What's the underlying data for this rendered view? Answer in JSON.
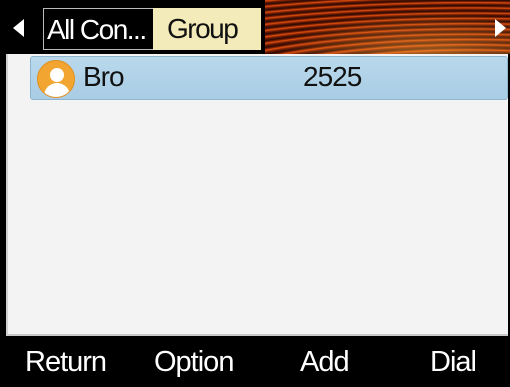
{
  "tabs": [
    {
      "label": "All Con..."
    },
    {
      "label": "Group"
    }
  ],
  "contacts": [
    {
      "name": "Bro",
      "number": "2525"
    }
  ],
  "softkeys": {
    "return_label": "Return",
    "option_label": "Option",
    "add_label": "Add",
    "dial_label": "Dial"
  },
  "icons": {
    "left": "arrow-left-icon",
    "right": "arrow-right-icon",
    "avatar": "person-icon"
  },
  "colors": {
    "selected_tab_bg": "#f3ebb9",
    "selected_row_bg": "#b9d8ec",
    "avatar_color": "#f3a531"
  }
}
